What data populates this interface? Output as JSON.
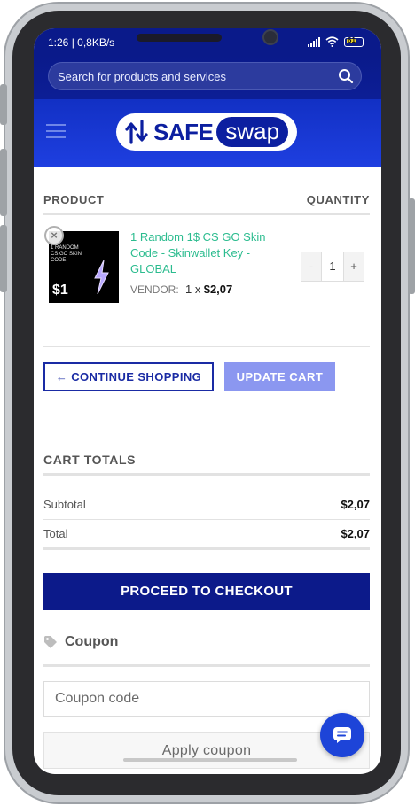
{
  "status_bar": {
    "time": "1:26 | 0,8KB/s",
    "battery": "61"
  },
  "search": {
    "placeholder": "Search for products and services"
  },
  "header": {
    "logo_left": "SAFE",
    "logo_right": "swap"
  },
  "cart": {
    "columns": [
      "PRODUCT",
      "QUANTITY"
    ],
    "item": {
      "image_caption": "1 RANDOM CS:GO SKIN CODE",
      "image_price": "$1",
      "name": "1 Random 1$ CS GO Skin Code - Skinwallet Key - GLOBAL",
      "vendor_label": "VENDOR:",
      "qty_text": "1 x",
      "price": "$2,07",
      "quantity": "1",
      "minus": "-",
      "plus": "+"
    },
    "continue_label": "← CONTINUE SHOPPING",
    "update_label": "UPDATE CART"
  },
  "totals": {
    "title": "CART TOTALS",
    "subtotal_label": "Subtotal",
    "subtotal_value": "$2,07",
    "total_label": "Total",
    "total_value": "$2,07",
    "checkout_label": "PROCEED TO CHECKOUT"
  },
  "coupon": {
    "title": "Coupon",
    "placeholder": "Coupon code",
    "apply_label": "Apply coupon"
  },
  "colors": {
    "brand_dark": "#0c1a8a",
    "brand": "#1e3fe0",
    "link_green": "#2cbc8f",
    "update_btn": "#8b97f0"
  }
}
